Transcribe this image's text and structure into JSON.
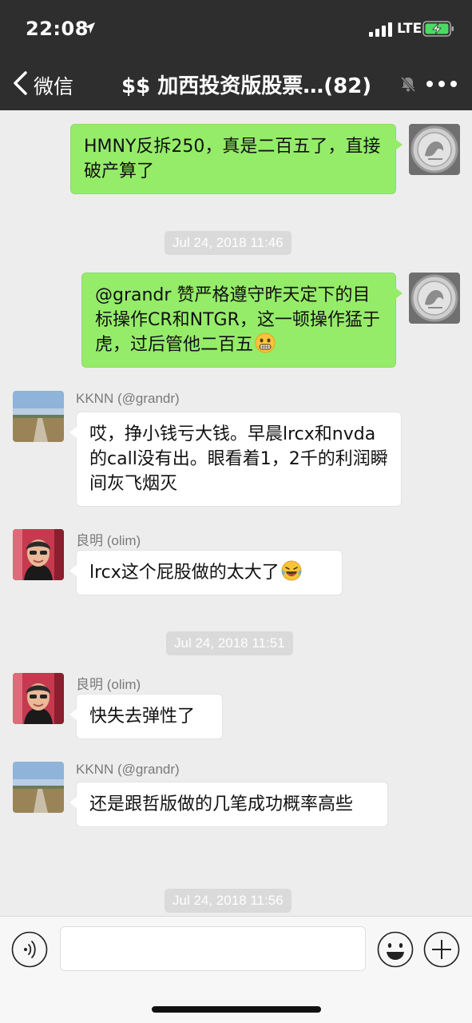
{
  "status_bar": {
    "time": "22:08",
    "network": "LTE"
  },
  "nav": {
    "back_label": "微信",
    "title": "$$ 加西投资版股票…(82)"
  },
  "messages": [
    {
      "kind": "outgoing",
      "text": "HMNY反拆250，真是二百五了，直接破产算了"
    },
    {
      "kind": "timestamp",
      "text": "Jul 24, 2018 11:46"
    },
    {
      "kind": "outgoing",
      "text": "@grandr 赞严格遵守昨天定下的目标操作CR和NTGR，这一顿操作猛于虎，过后管他二百五",
      "emoji": "grimacing-face"
    },
    {
      "kind": "incoming",
      "sender": "KKNN (@grandr)",
      "text": "哎，挣小钱亏大钱。早晨lrcx和nvda的call没有出。眼看着1，2千的利润瞬间灰飞烟灭"
    },
    {
      "kind": "incoming",
      "sender": "良明 (olim)",
      "text": "lrcx这个屁股做的太大了",
      "emoji": "rolling-on-floor-laughing"
    },
    {
      "kind": "timestamp",
      "text": "Jul 24, 2018 11:51"
    },
    {
      "kind": "incoming",
      "sender": "良明 (olim)",
      "text": "快失去弹性了"
    },
    {
      "kind": "incoming",
      "sender": "KKNN (@grandr)",
      "text": "还是跟哲版做的几笔成功概率高些"
    },
    {
      "kind": "timestamp",
      "text": "Jul 24, 2018 11:56"
    }
  ],
  "input": {
    "value": ""
  },
  "colors": {
    "header_bg": "#2e2e2e",
    "chat_bg": "#ededed",
    "outgoing_bubble": "#95ec69",
    "incoming_bubble": "#ffffff",
    "battery": "#4cd964"
  }
}
